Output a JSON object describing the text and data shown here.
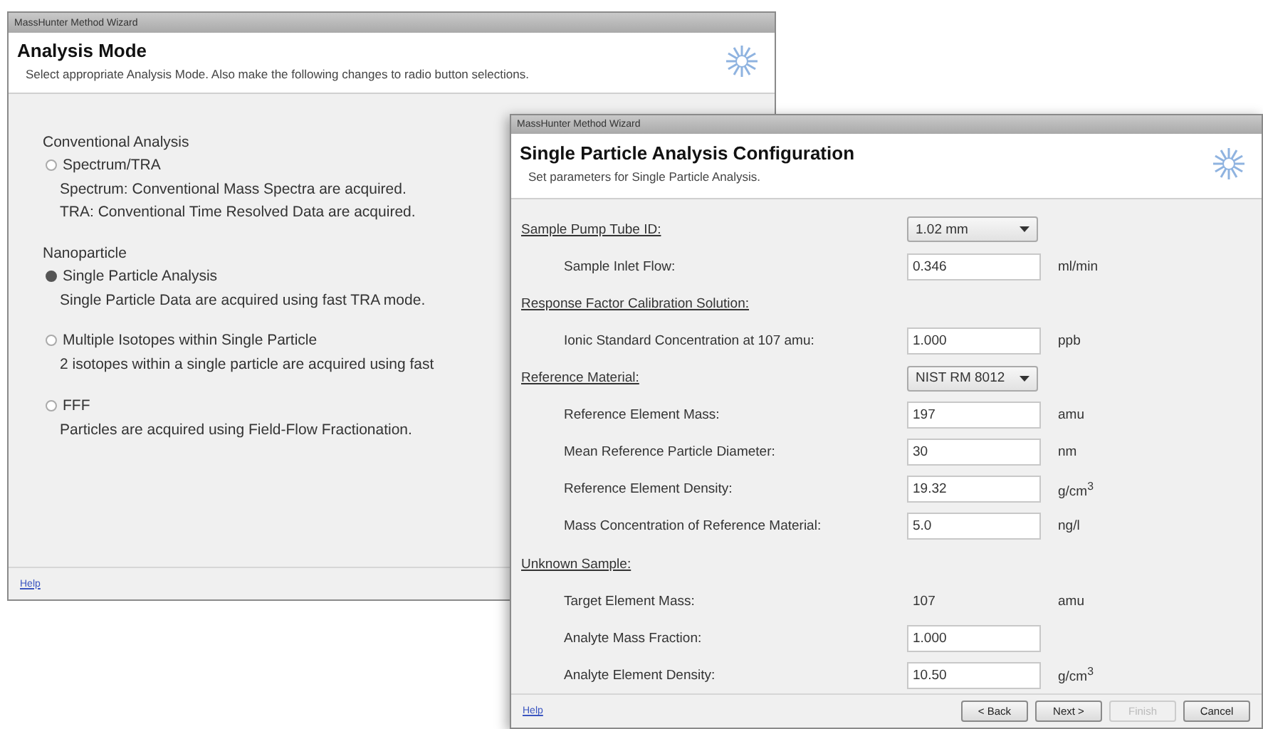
{
  "back_window": {
    "title": "MassHunter Method Wizard",
    "heading": "Analysis Mode",
    "subheading": "Select appropriate Analysis Mode. Also make the following changes to radio button selections.",
    "groups": [
      {
        "label": "Conventional Analysis",
        "options": [
          {
            "label": "Spectrum/TRA",
            "selected": false,
            "description": [
              "Spectrum: Conventional Mass Spectra are acquired.",
              "TRA: Conventional Time Resolved Data are acquired."
            ]
          }
        ]
      },
      {
        "label": "Nanoparticle",
        "options": [
          {
            "label": "Single Particle Analysis",
            "selected": true,
            "description": [
              "Single Particle Data are acquired using fast TRA mode."
            ]
          },
          {
            "label": "Multiple Isotopes within Single Particle",
            "selected": false,
            "description": [
              "2 isotopes within a single particle are acquired using fast"
            ]
          },
          {
            "label": "FFF",
            "selected": false,
            "description": [
              "Particles are acquired using Field-Flow Fractionation."
            ]
          }
        ]
      }
    ],
    "help": "Help"
  },
  "front_window": {
    "title": "MassHunter Method Wizard",
    "heading": "Single Particle Analysis Configuration",
    "subheading": "Set parameters for Single Particle Analysis.",
    "rows": [
      {
        "kind": "heading",
        "label": "Sample Pump Tube ID:",
        "select": "1.02 mm"
      },
      {
        "kind": "input",
        "label": "Sample Inlet Flow:",
        "value": "0.346",
        "unit": "ml/min"
      },
      {
        "kind": "heading",
        "label": "Response Factor Calibration Solution:"
      },
      {
        "kind": "input",
        "label": "Ionic Standard Concentration at 107 amu:",
        "value": "1.000",
        "unit": "ppb"
      },
      {
        "kind": "heading",
        "label": "Reference Material:",
        "select": "NIST RM 8012"
      },
      {
        "kind": "input",
        "label": "Reference Element Mass:",
        "value": "197",
        "unit": "amu"
      },
      {
        "kind": "input",
        "label": "Mean Reference Particle Diameter:",
        "value": "30",
        "unit": "nm"
      },
      {
        "kind": "input",
        "label": "Reference Element Density:",
        "value": "19.32",
        "unit": "g/cm$^{3}$"
      },
      {
        "kind": "input",
        "label": "Mass Concentration of Reference Material:",
        "value": "5.0",
        "unit": "ng/l"
      },
      {
        "kind": "heading",
        "label": "Unknown Sample:"
      },
      {
        "kind": "readonly",
        "label": "Target Element Mass:",
        "value": "107",
        "unit": "amu"
      },
      {
        "kind": "input",
        "label": "Analyte Mass Fraction:",
        "value": "1.000"
      },
      {
        "kind": "input",
        "label": "Analyte Element Density:",
        "value": "10.50",
        "unit": "g/cm$^{3}$"
      }
    ],
    "help": "Help",
    "buttons": [
      {
        "label": "< Back",
        "disabled": false
      },
      {
        "label": "Next >",
        "disabled": false
      },
      {
        "label": "Finish",
        "disabled": true
      },
      {
        "label": "Cancel",
        "disabled": false
      }
    ]
  }
}
